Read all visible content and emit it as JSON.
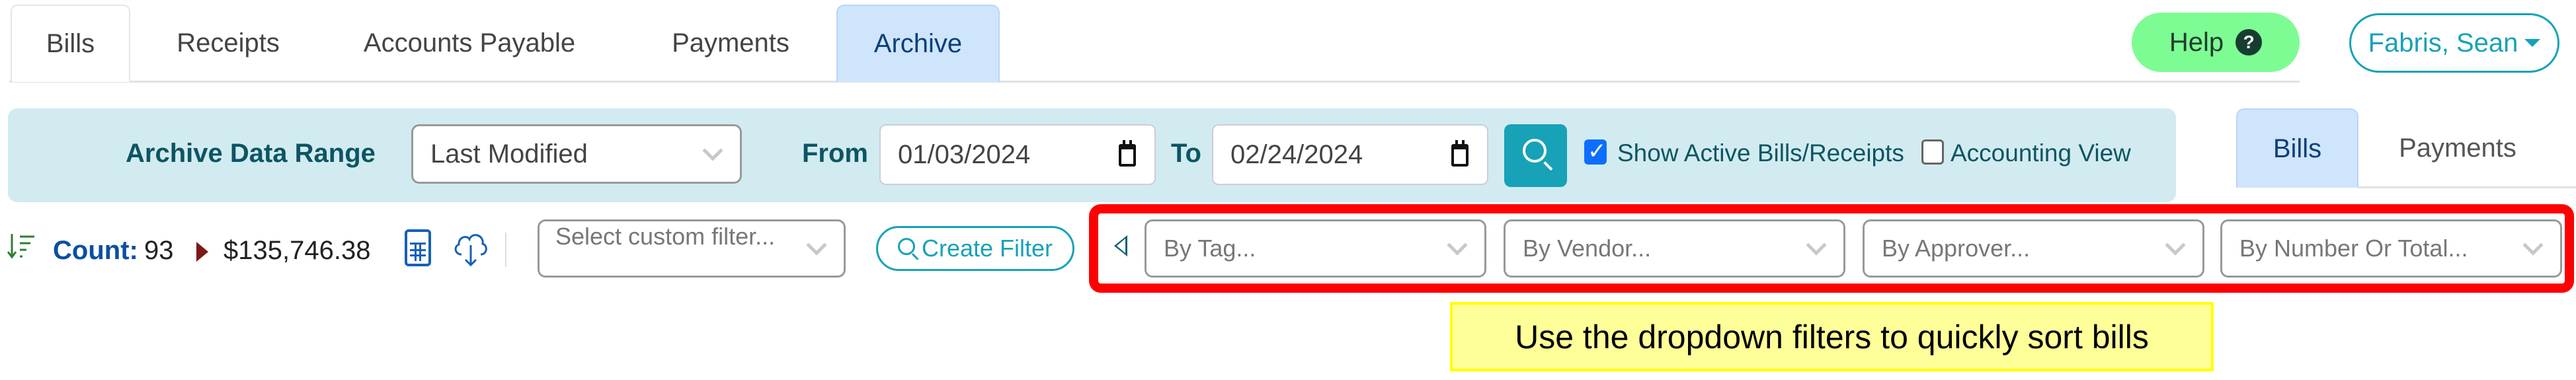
{
  "top_tabs": [
    {
      "label": "Bills",
      "active": false
    },
    {
      "label": "Receipts",
      "active": false
    },
    {
      "label": "Accounts Payable",
      "active": false
    },
    {
      "label": "Payments",
      "active": false
    },
    {
      "label": "Archive",
      "active": true
    }
  ],
  "header": {
    "help_label": "Help",
    "help_icon": "question-circle-icon",
    "user_name": "Fabris, Sean"
  },
  "filter_panel": {
    "range_label": "Archive Data Range",
    "range_select_value": "Last Modified",
    "from_label": "From",
    "from_value": "01/03/2024",
    "to_label": "To",
    "to_value": "02/24/2024",
    "search_icon": "search-icon",
    "show_active_label": "Show Active Bills/Receipts",
    "show_active_checked": true,
    "accounting_view_label": "Accounting View",
    "accounting_view_checked": false
  },
  "sub_tabs": [
    {
      "label": "Bills",
      "active": true
    },
    {
      "label": "Payments",
      "active": false
    }
  ],
  "summary": {
    "sort_icon": "sort-descending-icon",
    "count_label": "Count:",
    "count_value": "93",
    "total_value": "$135,746.38",
    "calculator_icon": "calculator-icon",
    "download_icon": "cloud-download-icon"
  },
  "custom_filter": {
    "placeholder": "Select custom filter...",
    "create_label": "Create Filter"
  },
  "dropdown_filters": [
    {
      "placeholder": "By Tag..."
    },
    {
      "placeholder": "By Vendor..."
    },
    {
      "placeholder": "By Approver..."
    },
    {
      "placeholder": "By Number Or Total..."
    }
  ],
  "annotation": {
    "callout_text": "Use the dropdown filters to quickly sort bills",
    "highlight_color": "#ff0000",
    "callout_color": "#ffff99"
  },
  "colors": {
    "accent": "#17a2b8",
    "active_tab": "#cfe5fc",
    "panel_bg": "#d2ebf0",
    "help_bg": "#7dfc94"
  }
}
